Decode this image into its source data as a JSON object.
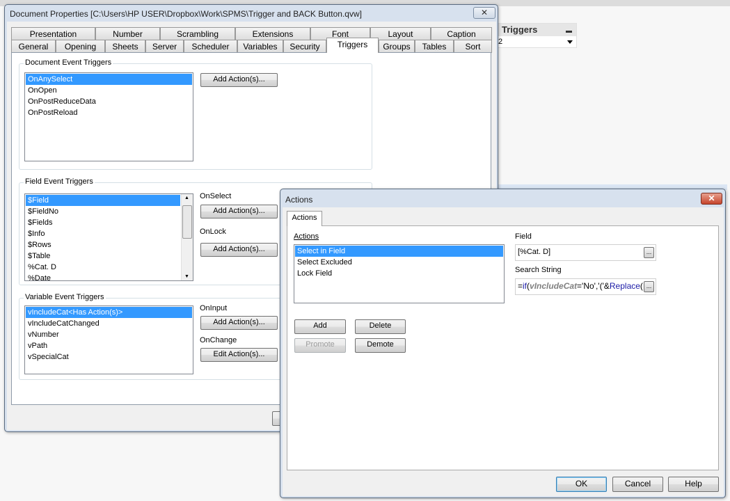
{
  "doc_props": {
    "title": "Document Properties [C:\\Users\\HP USER\\Dropbox\\Work\\SPMS\\Trigger and BACK Button.qvw]",
    "close": "✕",
    "tabs_row1": [
      "Presentation",
      "Number",
      "Scrambling",
      "Extensions",
      "Font",
      "Layout",
      "Caption"
    ],
    "tabs_row2": [
      "General",
      "Opening",
      "Sheets",
      "Server",
      "Scheduler",
      "Variables",
      "Security",
      "Triggers",
      "Groups",
      "Tables",
      "Sort"
    ],
    "active_tab": "Triggers",
    "document_triggers": {
      "label": "Document Event Triggers",
      "items": [
        "OnAnySelect",
        "OnOpen",
        "OnPostReduceData",
        "OnPostReload"
      ],
      "button": "Add Action(s)..."
    },
    "field_triggers": {
      "label": "Field Event Triggers",
      "items": [
        "$Field",
        "$FieldNo",
        "$Fields",
        "$Info",
        "$Rows",
        "$Table",
        "%Cat. D",
        "%Date"
      ],
      "on_select": "OnSelect",
      "on_lock": "OnLock",
      "button": "Add Action(s)..."
    },
    "variable_triggers": {
      "label": "Variable Event Triggers",
      "items": [
        "vIncludeCat<Has Action(s)>",
        "vIncludeCatChanged",
        "vNumber",
        "vPath",
        "vSpecialCat"
      ],
      "on_input": "OnInput",
      "on_change": "OnChange",
      "add_button": "Add Action(s)...",
      "edit_button": "Edit Action(s)..."
    }
  },
  "triggers_box": {
    "title": "Triggers",
    "value": "2"
  },
  "actions_dialog": {
    "title": "Actions",
    "close": "✕",
    "tab": "Actions",
    "actions_label": "Actions",
    "actions": [
      "Select in Field",
      "Select Excluded",
      "Lock Field"
    ],
    "field_label": "Field",
    "field_value": "[%Cat. D]",
    "search_label": "Search String",
    "search_parts": {
      "eq": "=",
      "fn": "if",
      "p1": "(",
      "var": "vIncludeCat",
      "rest": "='No','('&",
      "fn2": "Replace",
      "p2": "("
    },
    "dots": "...",
    "buttons": {
      "add": "Add",
      "delete": "Delete",
      "promote": "Promote",
      "demote": "Demote",
      "ok": "OK",
      "cancel": "Cancel",
      "help": "Help"
    }
  }
}
